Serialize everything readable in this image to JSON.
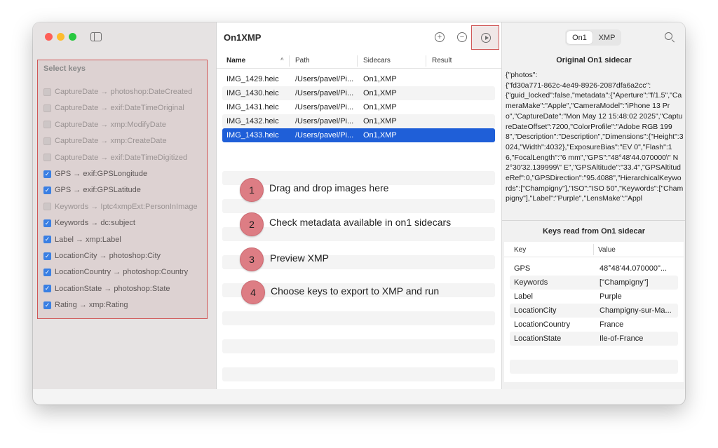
{
  "app": {
    "title": "On1XMP"
  },
  "sidebar": {
    "title": "Select keys",
    "keys": [
      {
        "label": "CaptureDate → photoshop:DateCreated",
        "checked": false
      },
      {
        "label": "CaptureDate → exif:DateTimeOriginal",
        "checked": false
      },
      {
        "label": "CaptureDate → xmp:ModifyDate",
        "checked": false
      },
      {
        "label": "CaptureDate → xmp:CreateDate",
        "checked": false
      },
      {
        "label": "CaptureDate → exif:DateTimeDigitized",
        "checked": false
      },
      {
        "label": "GPS → exif:GPSLongitude",
        "checked": true
      },
      {
        "label": "GPS → exif:GPSLatitude",
        "checked": true
      },
      {
        "label": "Keywords → Iptc4xmpExt:PersonInImage",
        "checked": false
      },
      {
        "label": "Keywords → dc:subject",
        "checked": true
      },
      {
        "label": "Label → xmp:Label",
        "checked": true
      },
      {
        "label": "LocationCity → photoshop:City",
        "checked": true
      },
      {
        "label": "LocationCountry → photoshop:Country",
        "checked": true
      },
      {
        "label": "LocationState → photoshop:State",
        "checked": true
      },
      {
        "label": "Rating → xmp:Rating",
        "checked": true
      }
    ]
  },
  "toolbar": {
    "add_icon": "plus-circle-icon",
    "remove_icon": "minus-circle-icon",
    "run_icon": "play-circle-icon"
  },
  "files": {
    "columns": [
      "Name",
      "Path",
      "Sidecars",
      "Result"
    ],
    "rows": [
      {
        "name": "IMG_1429.heic",
        "path": "/Users/pavel/Pi...",
        "sidecars": "On1,XMP",
        "result": ""
      },
      {
        "name": "IMG_1430.heic",
        "path": "/Users/pavel/Pi...",
        "sidecars": "On1,XMP",
        "result": ""
      },
      {
        "name": "IMG_1431.heic",
        "path": "/Users/pavel/Pi...",
        "sidecars": "On1,XMP",
        "result": ""
      },
      {
        "name": "IMG_1432.heic",
        "path": "/Users/pavel/Pi...",
        "sidecars": "On1,XMP",
        "result": ""
      },
      {
        "name": "IMG_1433.heic",
        "path": "/Users/pavel/Pi...",
        "sidecars": "On1,XMP",
        "result": "",
        "selected": true
      }
    ]
  },
  "steps": [
    {
      "number": "1",
      "text": "Drag and drop images here"
    },
    {
      "number": "2",
      "text": "Check metadata available in on1 sidecars"
    },
    {
      "number": "3",
      "text": "Preview XMP"
    },
    {
      "number": "4",
      "text": "Choose keys to export to XMP and run"
    }
  ],
  "inspector": {
    "segments": [
      "On1",
      "XMP"
    ],
    "active_segment": "On1",
    "original_title": "Original On1 sidecar",
    "original_json": "{\"photos\":\n{\"fd30a771-862c-4e49-8926-2087dfa6a2cc\":\n{\"guid_locked\":false,\"metadata\":{\"Aperture\":\"f/1.5\",\"CameraMake\":\"Apple\",\"CameraModel\":\"iPhone 13 Pro\",\"CaptureDate\":\"Mon May 12 15:48:02 2025\",\"CaptureDateOffset\":7200,\"ColorProfile\":\"Adobe RGB 1998\",\"Description\":\"Description\",\"Dimensions\":{\"Height\":3024,\"Width\":4032},\"ExposureBias\":\"EV 0\",\"Flash\":16,\"FocalLength\":\"6 mm\",\"GPS\":\"48°48'44.070000\\\" N 2°30'32.139999\\\" E\",\"GPSAltitude\":\"33.4\",\"GPSAltitudeRef\":0,\"GPSDirection\":\"95.4088\",\"HierarchicalKeywords\":[\"Champigny\"],\"ISO\":\"ISO 50\",\"Keywords\":[\"Champigny\"],\"Label\":\"Purple\",\"LensMake\":\"Appl",
    "keys_title": "Keys read from On1 sidecar",
    "columns": [
      "Key",
      "Value"
    ],
    "rows": [
      {
        "key": "GPS",
        "value": "48°48'44.070000\"..."
      },
      {
        "key": "Keywords",
        "value": "[\"Champigny\"]"
      },
      {
        "key": "Label",
        "value": "Purple"
      },
      {
        "key": "LocationCity",
        "value": "Champigny-sur-Ma..."
      },
      {
        "key": "LocationCountry",
        "value": "France"
      },
      {
        "key": "LocationState",
        "value": "Ile-of-France"
      }
    ]
  },
  "colors": {
    "accent": "#1f5fd8",
    "highlight_border": "#d05757",
    "step_badge": "#dd7d84"
  }
}
